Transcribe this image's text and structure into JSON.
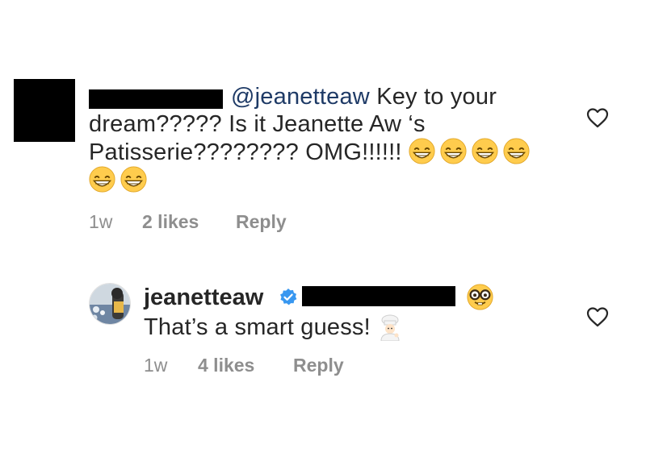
{
  "comments": [
    {
      "mention": "@jeanetteaw",
      "text_line1": "Key to your",
      "text_line2": "dream????? Is it Jeanette Aw ‘s",
      "text_line3": "Patisserie???????? OMG!!!!!!",
      "emojis": [
        "grinning-face",
        "grinning-face",
        "grinning-face",
        "grinning-face",
        "grinning-face",
        "grinning-face"
      ],
      "time": "1w",
      "likes": "2 likes",
      "reply": "Reply"
    },
    {
      "username": "jeanetteaw",
      "verified": true,
      "text": "That’s a smart guess!",
      "emojis_after_text": [
        "cook"
      ],
      "emoji_after_mention": "nerd-face",
      "time": "1w",
      "likes": "4 likes",
      "reply": "Reply"
    }
  ],
  "colors": {
    "text": "#262626",
    "mention": "#1e3a66",
    "meta": "#8e8e8e",
    "verified": "#3897f0",
    "redaction": "#000000"
  },
  "icons": [
    "heart-outline-icon",
    "verified-badge-icon"
  ]
}
